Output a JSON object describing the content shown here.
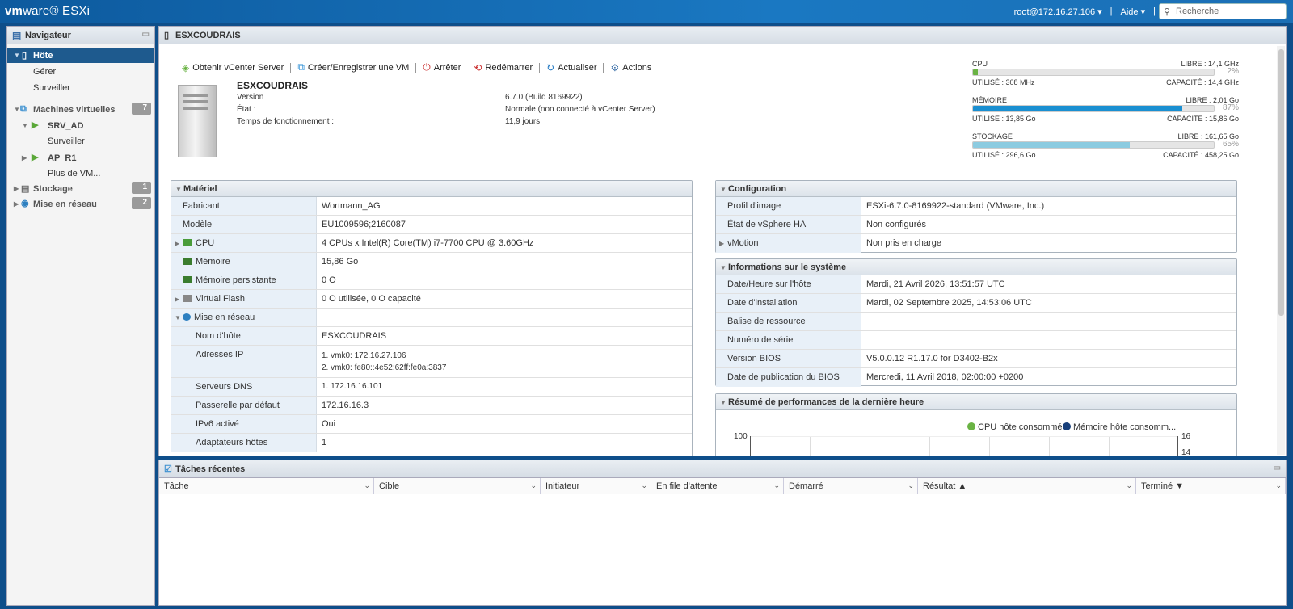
{
  "topbar": {
    "brand_vm": "vm",
    "brand_ware": "ware",
    "brand_product": "ESXi",
    "user": "root@172.16.27.106",
    "help": "Aide",
    "search_placeholder": "Recherche"
  },
  "navigator": {
    "title": "Navigateur",
    "items": [
      {
        "label": "Hôte"
      },
      {
        "label": "Gérer"
      },
      {
        "label": "Surveiller"
      },
      {
        "label": "Machines virtuelles",
        "count": "7"
      },
      {
        "label": "SRV_AD"
      },
      {
        "label": "Surveiller"
      },
      {
        "label": "AP_R1"
      },
      {
        "label": "Plus de VM..."
      },
      {
        "label": "Stockage",
        "count": "1"
      },
      {
        "label": "Mise en réseau",
        "count": "2"
      }
    ]
  },
  "main": {
    "title": "ESXCOUDRAIS",
    "toolbar": [
      "Obtenir vCenter Server",
      "Créer/Enregistrer une VM",
      "Arrêter",
      "Redémarrer",
      "Actualiser",
      "Actions"
    ],
    "host": {
      "name": "ESXCOUDRAIS",
      "labels": [
        "Version :",
        "État :",
        "Temps de fonctionnement :"
      ],
      "values": [
        "6.7.0 (Build 8169922)",
        "Normale (non connecté à vCenter Server)",
        "11,9 jours"
      ]
    },
    "resources": [
      {
        "name": "CPU",
        "free": "LIBRE : 14,1 GHz",
        "pct": "2%",
        "pct_value": 2,
        "used": "UTILISÉ : 308 MHz",
        "capacity": "CAPACITÉ : 14,4 GHz",
        "color": "#6ab344"
      },
      {
        "name": "MÉMOIRE",
        "free": "LIBRE : 2,01 Go",
        "pct": "87%",
        "pct_value": 87,
        "used": "UTILISÉ : 13,85 Go",
        "capacity": "CAPACITÉ : 15,86 Go",
        "color": "#1a8fd1"
      },
      {
        "name": "STOCKAGE",
        "free": "LIBRE : 161,65 Go",
        "pct": "65%",
        "pct_value": 65,
        "used": "UTILISÉ : 296,6 Go",
        "capacity": "CAPACITÉ : 458,25 Go",
        "color": "#8ccbe0"
      }
    ],
    "hardware": {
      "title": "Matériel",
      "rows": [
        {
          "k": "Fabricant",
          "v": "Wortmann_AG"
        },
        {
          "k": "Modèle",
          "v": "EU1009596;2160087"
        },
        {
          "k": "CPU",
          "v": "4 CPUs x Intel(R) Core(TM) i7-7700 CPU @ 3.60GHz"
        },
        {
          "k": "Mémoire",
          "v": "15,86 Go"
        },
        {
          "k": "Mémoire persistante",
          "v": "0 O"
        },
        {
          "k": "Virtual Flash",
          "v": "0 O utilisée, 0 O capacité"
        },
        {
          "k": "Mise en réseau",
          "v": ""
        },
        {
          "k": "Nom d'hôte",
          "v": "ESXCOUDRAIS"
        },
        {
          "k": "Adresses IP",
          "v": "1. vmk0: 172.16.27.106",
          "v2": "2. vmk0: fe80::4e52:62ff:fe0a:3837"
        },
        {
          "k": "Serveurs DNS",
          "v": "1. 172.16.16.101"
        },
        {
          "k": "Passerelle par défaut",
          "v": "172.16.16.3"
        },
        {
          "k": "IPv6 activé",
          "v": "Oui"
        },
        {
          "k": "Adaptateurs hôtes",
          "v": "1"
        }
      ]
    },
    "configuration": {
      "title": "Configuration",
      "rows": [
        {
          "k": "Profil d'image",
          "v": "ESXi-6.7.0-8169922-standard (VMware, Inc.)"
        },
        {
          "k": "État de vSphere HA",
          "v": "Non configurés"
        },
        {
          "k": "vMotion",
          "v": "Non pris en charge"
        }
      ]
    },
    "sysinfo": {
      "title": "Informations sur le système",
      "rows": [
        {
          "k": "Date/Heure sur l'hôte",
          "v": "Mardi, 21 Avril 2026, 13:51:57 UTC"
        },
        {
          "k": "Date d'installation",
          "v": "Mardi, 02 Septembre 2025, 14:53:06 UTC"
        },
        {
          "k": "Balise de ressource",
          "v": ""
        },
        {
          "k": "Numéro de série",
          "v": ""
        },
        {
          "k": "Version BIOS",
          "v": "V5.0.0.12 R1.17.0 for D3402-B2x"
        },
        {
          "k": "Date de publication du BIOS",
          "v": "Mercredi, 11 Avril 2018, 02:00:00 +0200"
        }
      ]
    },
    "perf": {
      "title": "Résumé de performances de la dernière heure",
      "legend": [
        "CPU hôte consommé",
        "Mémoire hôte consomm..."
      ],
      "y_left_top": "100",
      "y_right_top": "16",
      "y_right_second": "14"
    }
  },
  "tasks": {
    "title": "Tâches récentes",
    "columns": [
      "Tâche",
      "Cible",
      "Initiateur",
      "En file d'attente",
      "Démarré",
      "Résultat ▲",
      "Terminé ▼"
    ]
  }
}
